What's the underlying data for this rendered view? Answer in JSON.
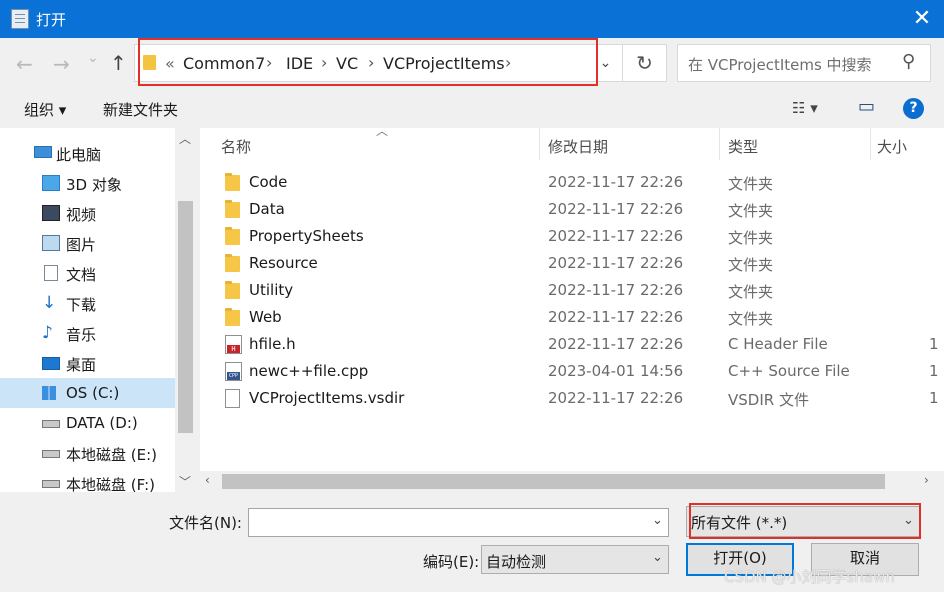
{
  "window": {
    "title": "打开",
    "close_glyph": "✕"
  },
  "nav": {
    "back_glyph": "←",
    "forward_glyph": "→",
    "recent_glyph": "⌄",
    "up_glyph": "↑",
    "breadcrumb_prefix": "«",
    "breadcrumb": [
      "Common7",
      "IDE",
      "VC",
      "VCProjectItems"
    ],
    "sep": "›",
    "dropdown_glyph": "⌄",
    "refresh_glyph": "↻",
    "search_placeholder": "在 VCProjectItems 中搜索",
    "search_glyph": "⚲"
  },
  "toolbar": {
    "organize": "组织 ▾",
    "new_folder": "新建文件夹",
    "view_glyph": "☷ ▾",
    "pane_glyph": "▭",
    "help_glyph": "?"
  },
  "sidebar": {
    "items": [
      {
        "label": "此电脑",
        "icon": "computer-icon",
        "selected": false
      },
      {
        "label": "3D 对象",
        "icon": "cube-3d-icon",
        "selected": false
      },
      {
        "label": "视频",
        "icon": "video-icon",
        "selected": false
      },
      {
        "label": "图片",
        "icon": "picture-icon",
        "selected": false
      },
      {
        "label": "文档",
        "icon": "document-icon",
        "selected": false
      },
      {
        "label": "下载",
        "icon": "download-icon",
        "selected": false
      },
      {
        "label": "音乐",
        "icon": "music-icon",
        "selected": false
      },
      {
        "label": "桌面",
        "icon": "desktop-icon",
        "selected": false
      },
      {
        "label": "OS (C:)",
        "icon": "windows-drive-icon",
        "selected": true
      },
      {
        "label": "DATA (D:)",
        "icon": "drive-icon",
        "selected": false
      },
      {
        "label": "本地磁盘 (E:)",
        "icon": "drive-icon",
        "selected": false
      },
      {
        "label": "本地磁盘 (F:)",
        "icon": "drive-icon",
        "selected": false
      }
    ],
    "scroll_up": "︿",
    "scroll_down": "﹀"
  },
  "filelist": {
    "columns": {
      "name": "名称",
      "date": "修改日期",
      "type": "类型",
      "size": "大小",
      "sort_glyph": "︿"
    },
    "rows": [
      {
        "name": "Code",
        "date": "2022-11-17 22:26",
        "type": "文件夹",
        "size": "",
        "icon": "folder-icon"
      },
      {
        "name": "Data",
        "date": "2022-11-17 22:26",
        "type": "文件夹",
        "size": "",
        "icon": "folder-icon"
      },
      {
        "name": "PropertySheets",
        "date": "2022-11-17 22:26",
        "type": "文件夹",
        "size": "",
        "icon": "folder-icon"
      },
      {
        "name": "Resource",
        "date": "2022-11-17 22:26",
        "type": "文件夹",
        "size": "",
        "icon": "folder-icon"
      },
      {
        "name": "Utility",
        "date": "2022-11-17 22:26",
        "type": "文件夹",
        "size": "",
        "icon": "folder-icon"
      },
      {
        "name": "Web",
        "date": "2022-11-17 22:26",
        "type": "文件夹",
        "size": "",
        "icon": "folder-icon"
      },
      {
        "name": "hfile.h",
        "date": "2022-11-17 22:26",
        "type": "C Header File",
        "size": "1",
        "icon": "h-file-icon"
      },
      {
        "name": "newc++file.cpp",
        "date": "2023-04-01 14:56",
        "type": "C++ Source File",
        "size": "1",
        "icon": "cpp-file-icon"
      },
      {
        "name": "VCProjectItems.vsdir",
        "date": "2022-11-17 22:26",
        "type": "VSDIR 文件",
        "size": "1",
        "icon": "file-icon"
      }
    ],
    "hscroll_left": "‹",
    "hscroll_right": "›"
  },
  "footer": {
    "filename_label": "文件名(N):",
    "filename_value": "",
    "filetype_value": "所有文件  (*.*)",
    "encoding_label": "编码(E):",
    "encoding_value": "自动检测",
    "open_button": "打开(O)",
    "cancel_button": "取消",
    "combo_glyph": "⌄",
    "watermark": "CSDN @小刘同学shawn"
  },
  "colors": {
    "titlebar": "#0a72d6",
    "selection": "#cce4f7",
    "highlight_box": "#e0302a",
    "help": "#0a6ed1"
  }
}
